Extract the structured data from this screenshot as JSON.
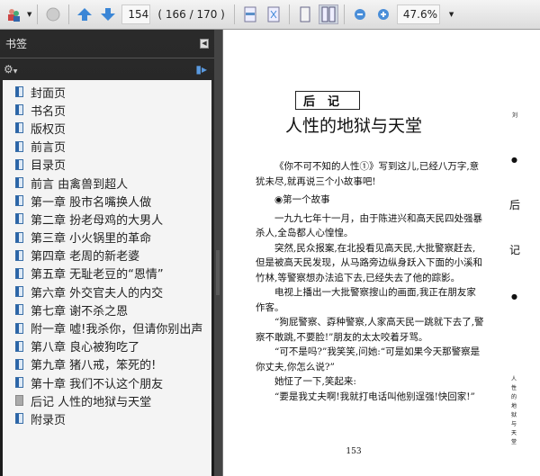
{
  "toolbar": {
    "page_input": "154",
    "page_count": "( 166 / 170 )",
    "zoom": "47.6%"
  },
  "sidebar": {
    "title": "书签",
    "items": [
      {
        "label": "封面页",
        "icon": "bookmark-icon"
      },
      {
        "label": "书名页",
        "icon": "bookmark-icon"
      },
      {
        "label": "版权页",
        "icon": "bookmark-icon"
      },
      {
        "label": "前言页",
        "icon": "bookmark-icon"
      },
      {
        "label": "目录页",
        "icon": "bookmark-icon"
      },
      {
        "label": "前言 由禽兽到超人",
        "icon": "bookmark-icon"
      },
      {
        "label": "第一章 股市名嘴换人做",
        "icon": "bookmark-icon"
      },
      {
        "label": "第二章 扮老母鸡的大男人",
        "icon": "bookmark-icon"
      },
      {
        "label": "第三章 小火锅里的革命",
        "icon": "bookmark-icon"
      },
      {
        "label": "第四章 老周的新老婆",
        "icon": "bookmark-icon"
      },
      {
        "label": "第五章 无耻老豆的“恩情”",
        "icon": "bookmark-icon"
      },
      {
        "label": "第六章 外交官夫人的内交",
        "icon": "bookmark-icon"
      },
      {
        "label": "第七章 谢不杀之恩",
        "icon": "bookmark-icon"
      },
      {
        "label": "附一章 嘘!我杀你，但请你别出声",
        "icon": "bookmark-icon"
      },
      {
        "label": "第八章 良心被狗吃了",
        "icon": "bookmark-icon"
      },
      {
        "label": "第九章 猪八戒，笨死的!",
        "icon": "bookmark-icon"
      },
      {
        "label": "第十章 我们不认这个朋友",
        "icon": "bookmark-icon"
      },
      {
        "label": "后记 人性的地狱与天堂",
        "icon": "bookmark-current-icon"
      },
      {
        "label": "附录页",
        "icon": "bookmark-icon"
      }
    ]
  },
  "page": {
    "section": "后记",
    "title": "人性的地狱与天堂",
    "paragraphs": [
      "《你不可不知的人性①》写到这儿,已经八万字,意犹未尽,就再说三个小故事吧!",
      "◉第一个故事",
      "一九九七年十一月，由于陈进兴和高天民四处强暴杀人,全岛都人心惶惶。",
      "突然,民众报案,在北投看见高天民,大批警察赶去,但是被高天民发现，从马路旁边纵身跃入下面的小溪和竹林,等警察想办法追下去,已经失去了他的踪影。",
      "电视上播出一大批警察搜山的画面,我正在朋友家作客。",
      "“狗屁警察、孬种警察,人家高天民一跳就下去了,警察不敢跳,不要脸!”朋友的太太咬着牙骂。",
      "“可不是吗?”我笑笑,问她:“可是如果今天那警察是你丈夫,你怎么说?”",
      "她怔了一下,笑起来:",
      "“要是我丈夫啊!我就打电话叫他别逞强!快回家!”"
    ],
    "page_number": "153",
    "margin_top": "刘",
    "margin_mid": "后",
    "margin_mid2": "记",
    "margin_running": "人性的地狱与天堂"
  }
}
